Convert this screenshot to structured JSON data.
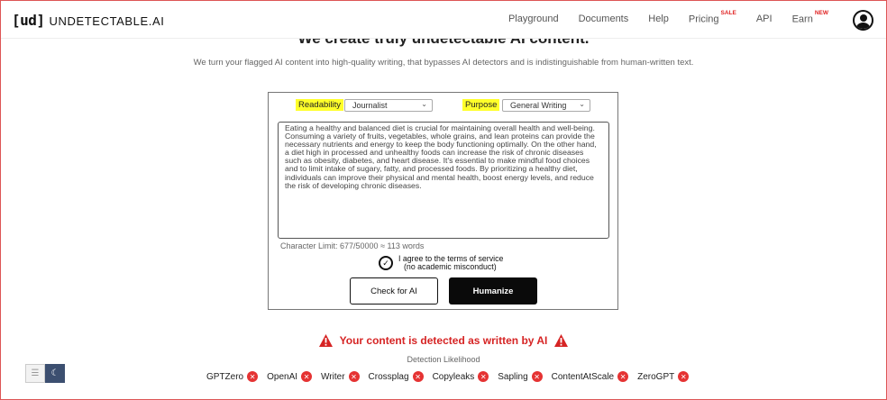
{
  "header": {
    "logo_mark": "[ud]",
    "logo_text": "UNDETECTABLE.AI",
    "nav": [
      {
        "label": "Playground",
        "badge": ""
      },
      {
        "label": "Documents",
        "badge": ""
      },
      {
        "label": "Help",
        "badge": ""
      },
      {
        "label": "Pricing",
        "badge": "SALE"
      },
      {
        "label": "API",
        "badge": ""
      },
      {
        "label": "Earn",
        "badge": "NEW"
      }
    ],
    "avatar_icon": "user-circle-icon"
  },
  "hero": {
    "headline": "We create truly undetectable AI content.",
    "subtitle": "We turn your flagged AI content into high-quality writing, that bypasses AI detectors and is indistinguishable from human-written text."
  },
  "form": {
    "readability_label": "Readability",
    "readability_value": "Journalist",
    "purpose_label": "Purpose",
    "purpose_value": "General Writing",
    "text": "Eating a healthy and balanced diet is crucial for maintaining overall health and well-being. Consuming a variety of fruits, vegetables, whole grains, and lean proteins can provide the necessary nutrients and energy to keep the body functioning optimally. On the other hand, a diet high in processed and unhealthy foods can increase the risk of chronic diseases such as obesity, diabetes, and heart disease. It's essential to make mindful food choices and to limit intake of sugary, fatty, and processed foods. By prioritizing a healthy diet, individuals can improve their physical and mental health, boost energy levels, and reduce the risk of developing chronic diseases.",
    "char_limit": "Character Limit: 677/50000 ≈ 113 words",
    "agree_line1": "I agree to the terms of service",
    "agree_line2": "(no academic misconduct)",
    "check_button": "Check for AI",
    "humanize_button": "Humanize"
  },
  "detection": {
    "warning": "Your content is detected as written by AI",
    "likelihood_label": "Detection Likelihood",
    "detectors": [
      "GPTZero",
      "OpenAI",
      "Writer",
      "Crossplag",
      "Copyleaks",
      "Sapling",
      "ContentAtScale",
      "ZeroGPT"
    ]
  },
  "colors": {
    "highlight": "#ffff2a",
    "warning_red": "#d62424",
    "badge_red": "#e02525",
    "dark_button": "#0a0a0a",
    "toggle_active": "#3c4f70"
  }
}
